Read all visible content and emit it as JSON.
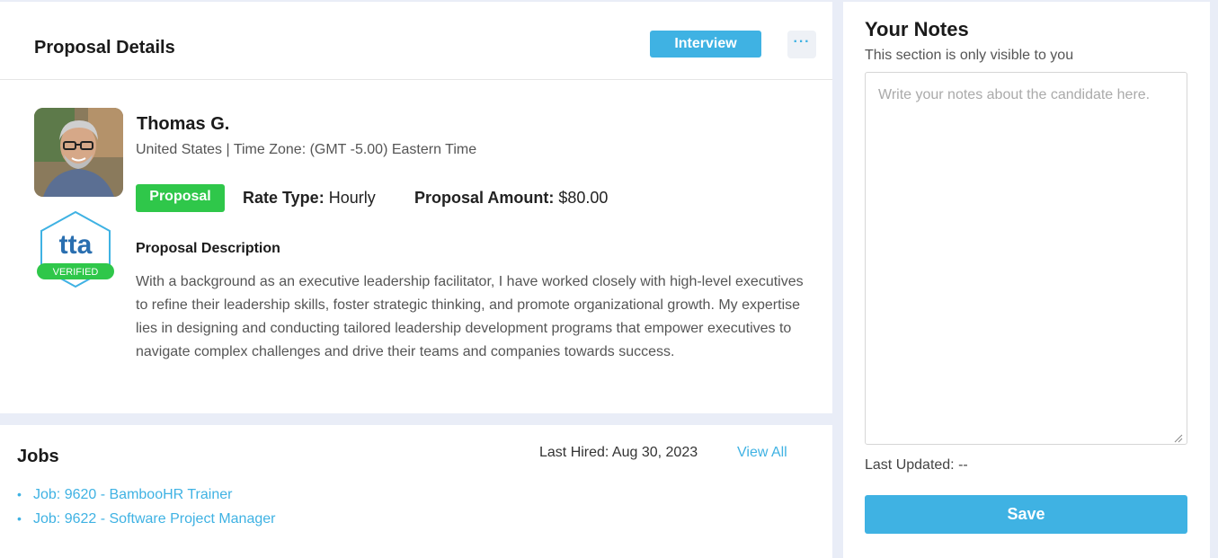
{
  "proposal": {
    "title": "Proposal Details",
    "interview_label": "Interview",
    "more_label": "···",
    "candidate": {
      "name": "Thomas G.",
      "location": "United States | Time Zone: (GMT -5.00) Eastern Time",
      "badge_text": "tta",
      "badge_verified": "VERIFIED"
    },
    "tag": "Proposal",
    "rate_type_label": "Rate Type:",
    "rate_type_value": "Hourly",
    "amount_label": "Proposal Amount:",
    "amount_value": "$80.00",
    "description_heading": "Proposal Description",
    "description": "With a background as an executive leadership facilitator, I have worked closely with high-level executives to refine their leadership skills, foster strategic thinking, and promote organizational growth. My expertise lies in designing and conducting tailored leadership development programs that empower executives to navigate complex challenges and drive their teams and companies towards success."
  },
  "jobs": {
    "title": "Jobs",
    "last_hired": "Last Hired: Aug 30, 2023",
    "view_all": "View All",
    "items": [
      {
        "label": "Job: 9620 - BambooHR Trainer"
      },
      {
        "label": "Job: 9622 - Software Project Manager"
      }
    ]
  },
  "notes": {
    "title": "Your Notes",
    "subtitle": "This section is only visible to you",
    "placeholder": "Write your notes about the candidate here.",
    "value": "",
    "last_updated": "Last Updated: --",
    "save_label": "Save"
  },
  "colors": {
    "accent": "#3fb2e3",
    "success": "#2fc74a",
    "background": "#e9edf7"
  },
  "icons": {
    "more": "more-dots-icon",
    "badge": "tta-verified-badge-icon",
    "resize": "resize-grip-icon"
  }
}
